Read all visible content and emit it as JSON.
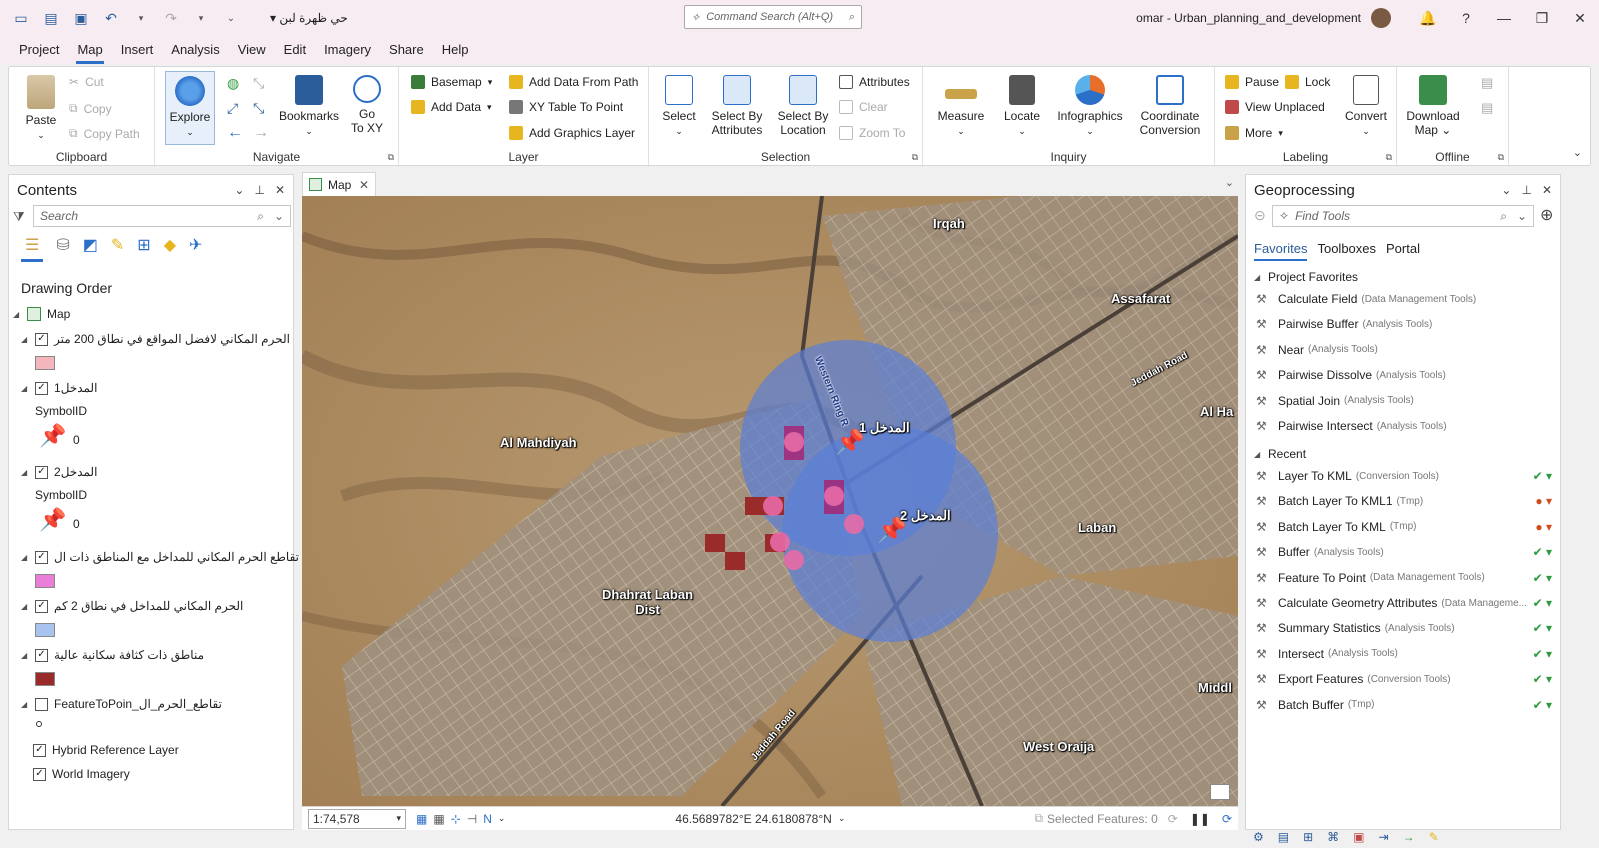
{
  "project_name": "حي ظهرة لبن",
  "command_search": {
    "placeholder": "Command Search (Alt+Q)"
  },
  "title": "omar - Urban_planning_and_development",
  "menu": [
    "Project",
    "Map",
    "Insert",
    "Analysis",
    "View",
    "Edit",
    "Imagery",
    "Share",
    "Help"
  ],
  "ribbon": {
    "clipboard": {
      "label": "Clipboard",
      "paste": "Paste",
      "cut": "Cut",
      "copy": "Copy",
      "copy_path": "Copy Path"
    },
    "navigate": {
      "label": "Navigate",
      "explore": "Explore",
      "bookmarks": "Bookmarks",
      "go_to_xy_1": "Go",
      "go_to_xy_2": "To XY"
    },
    "layer": {
      "label": "Layer",
      "basemap": "Basemap",
      "add_data": "Add Data",
      "add_data_from_path": "Add Data From Path",
      "xy_table": "XY Table To Point",
      "add_graphics": "Add Graphics Layer"
    },
    "selection": {
      "label": "Selection",
      "select": "Select",
      "select_by_attr_1": "Select By",
      "select_by_attr_2": "Attributes",
      "select_by_loc_1": "Select By",
      "select_by_loc_2": "Location",
      "attributes": "Attributes",
      "clear": "Clear",
      "zoom_to": "Zoom To"
    },
    "inquiry": {
      "label": "Inquiry",
      "measure": "Measure",
      "locate": "Locate",
      "infographics": "Infographics",
      "coord_1": "Coordinate",
      "coord_2": "Conversion"
    },
    "labeling": {
      "label": "Labeling",
      "pause": "Pause",
      "lock": "Lock",
      "view_unplaced": "View Unplaced",
      "more": "More",
      "convert": "Convert"
    },
    "offline": {
      "label": "Offline",
      "download_1": "Download",
      "download_2": "Map"
    }
  },
  "contents": {
    "title": "Contents",
    "search_placeholder": "Search",
    "drawing_order": "Drawing Order",
    "map": "Map",
    "layers": [
      {
        "name": "الحرم المكاني لافضل المواقع في نطاق 200 متر",
        "checked": true,
        "color": "#f4b6bd"
      },
      {
        "name": "المدخل1",
        "checked": true,
        "field": "SymbolID",
        "value": "0"
      },
      {
        "name": "المدخل2",
        "checked": true,
        "field": "SymbolID",
        "value": "0"
      },
      {
        "name": "تقاطع الحرم المكاني للمداخل مع المناطق ذات ال",
        "checked": true,
        "color": "#e97fd8"
      },
      {
        "name": "الحرم المكاني للمداخل في نطاق 2 كم",
        "checked": true,
        "color": "#a8c4ee"
      },
      {
        "name": "مناطق ذات كثافة سكانية عالية",
        "checked": true,
        "color": "#9a2b2b"
      },
      {
        "name": "تقاطع_الحرم_ال_FeatureToPoin",
        "checked": false
      },
      {
        "name": "Hybrid Reference Layer",
        "checked": true
      },
      {
        "name": "World Imagery",
        "checked": true
      }
    ]
  },
  "map_tab": "Map",
  "map_labels": {
    "irqah": "Irqah",
    "assafarat": "Assafarat",
    "al_mahdiyah": "Al Mahdiyah",
    "laban": "Laban",
    "dhahrat_1": "Dhahrat Laban",
    "dhahrat_2": "Dist",
    "west_oraija": "West Oraija",
    "jeddah_road": "Jeddah Road",
    "jeddah_road_2": "Jeddah Road",
    "western_ring": "Western Ring R",
    "al_ha": "Al Ha",
    "middl": "Middl",
    "entrance_1": "المدخل 1",
    "entrance_2": "المدخل 2"
  },
  "status": {
    "scale": "1:74,578",
    "coords": "46.5689782°E 24.6180878°N",
    "selected": "Selected Features: 0"
  },
  "geoprocessing": {
    "title": "Geoprocessing",
    "search_placeholder": "Find Tools",
    "tabs": [
      "Favorites",
      "Toolboxes",
      "Portal"
    ],
    "project_favorites": "Project Favorites",
    "favorites": [
      {
        "name": "Calculate Field",
        "box": "(Data Management Tools)"
      },
      {
        "name": "Pairwise Buffer",
        "box": "(Analysis Tools)"
      },
      {
        "name": "Near",
        "box": "(Analysis Tools)"
      },
      {
        "name": "Pairwise Dissolve",
        "box": "(Analysis Tools)"
      },
      {
        "name": "Spatial Join",
        "box": "(Analysis Tools)"
      },
      {
        "name": "Pairwise Intersect",
        "box": "(Analysis Tools)"
      }
    ],
    "recent_label": "Recent",
    "recent": [
      {
        "name": "Layer To KML",
        "box": "(Conversion Tools)",
        "status": "ok"
      },
      {
        "name": "Batch Layer To KML1",
        "box": "(Tmp)",
        "status": "warn"
      },
      {
        "name": "Batch Layer To KML",
        "box": "(Tmp)",
        "status": "warn"
      },
      {
        "name": "Buffer",
        "box": "(Analysis Tools)",
        "status": "ok"
      },
      {
        "name": "Feature To Point",
        "box": "(Data Management Tools)",
        "status": "ok"
      },
      {
        "name": "Calculate Geometry Attributes",
        "box": "(Data Manageme...",
        "status": "ok"
      },
      {
        "name": "Summary Statistics",
        "box": "(Analysis Tools)",
        "status": "ok"
      },
      {
        "name": "Intersect",
        "box": "(Analysis Tools)",
        "status": "ok"
      },
      {
        "name": "Export Features",
        "box": "(Conversion Tools)",
        "status": "ok"
      },
      {
        "name": "Batch Buffer",
        "box": "(Tmp)",
        "status": "ok"
      }
    ]
  }
}
